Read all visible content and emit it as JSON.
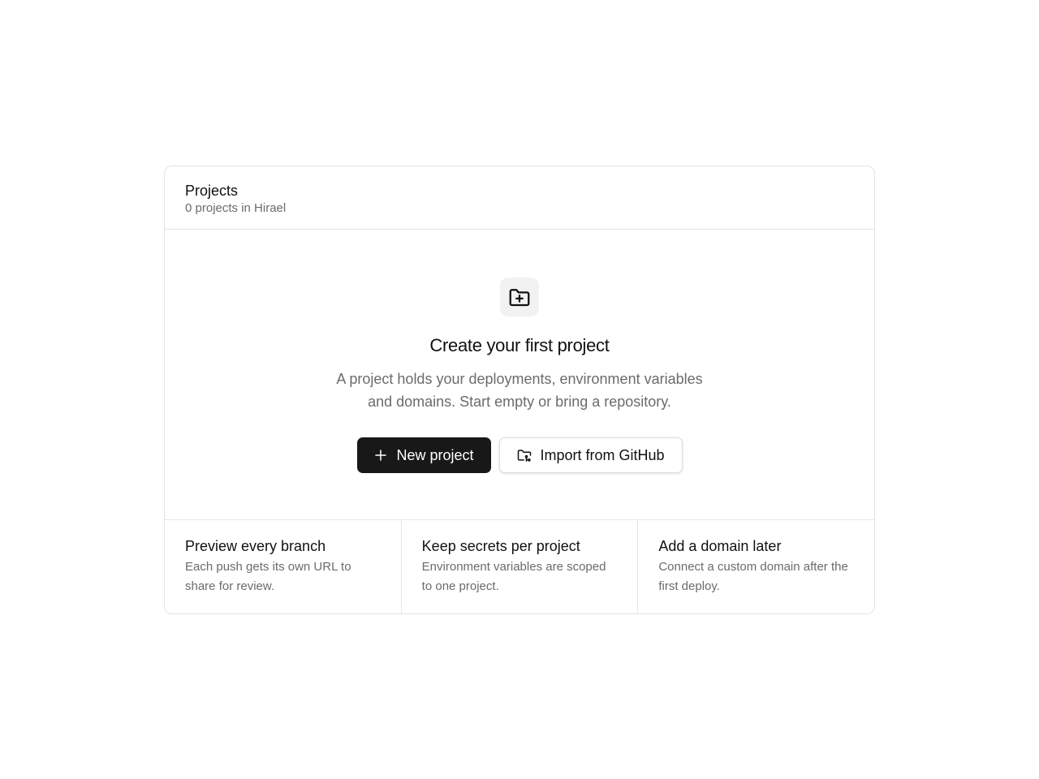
{
  "header": {
    "title": "Projects",
    "subtitle": "0 projects in Hirael"
  },
  "empty_state": {
    "icon": "folder-plus-icon",
    "title": "Create your first project",
    "description": "A project holds your deployments, environment variables and domains. Start empty or bring a repository.",
    "primary_button": {
      "label": "New project",
      "icon": "plus-icon"
    },
    "secondary_button": {
      "label": "Import from GitHub",
      "icon": "folder-git-icon"
    }
  },
  "features": [
    {
      "title": "Preview every branch",
      "description": "Each push gets its own URL to share for review."
    },
    {
      "title": "Keep secrets per project",
      "description": "Environment variables are scoped to one project."
    },
    {
      "title": "Add a domain later",
      "description": "Connect a custom domain after the first deploy."
    }
  ],
  "colors": {
    "primary_button_bg": "#181818",
    "muted_text": "#6b6b6b",
    "border": "#e3e3e3"
  }
}
